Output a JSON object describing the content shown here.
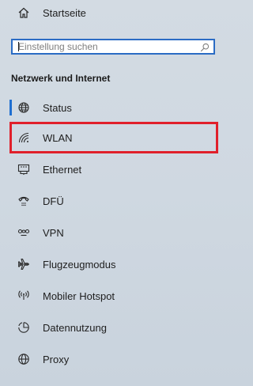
{
  "home": {
    "label": "Startseite",
    "icon": "home-icon"
  },
  "search": {
    "placeholder": "Einstellung suchen",
    "value": "",
    "icon": "search-icon"
  },
  "section": {
    "title": "Netzwerk und Internet"
  },
  "nav": {
    "items": [
      {
        "label": "Status",
        "icon": "globe-status-icon",
        "active": true
      },
      {
        "label": "WLAN",
        "icon": "wifi-icon",
        "highlighted": true
      },
      {
        "label": "Ethernet",
        "icon": "ethernet-icon"
      },
      {
        "label": "DFÜ",
        "icon": "dialup-icon"
      },
      {
        "label": "VPN",
        "icon": "vpn-icon"
      },
      {
        "label": "Flugzeugmodus",
        "icon": "airplane-icon"
      },
      {
        "label": "Mobiler Hotspot",
        "icon": "hotspot-icon"
      },
      {
        "label": "Datennutzung",
        "icon": "data-usage-icon"
      },
      {
        "label": "Proxy",
        "icon": "globe-icon"
      }
    ]
  },
  "colors": {
    "accent": "#1f6fd1",
    "highlight_border": "#e0202b",
    "background": "#cfd8e1",
    "search_border": "#2b6cc4"
  }
}
